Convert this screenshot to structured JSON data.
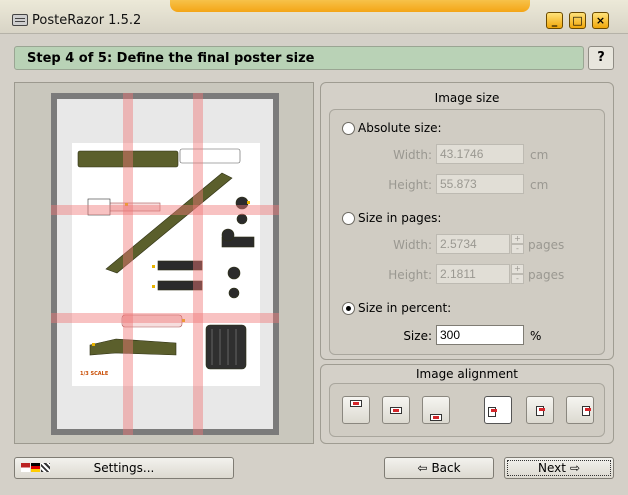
{
  "window": {
    "title": "PosteRazor 1.5.2",
    "minimize": "_",
    "maximize": "□",
    "close": "×"
  },
  "step": {
    "title": "Step 4 of 5: Define the final poster size",
    "help_label": "?"
  },
  "preview": {
    "scale_label": "1/3 SCALE"
  },
  "image_size": {
    "title": "Image size",
    "absolute": {
      "label": "Absolute size:",
      "width_label": "Width:",
      "width_value": "43.1746",
      "width_unit": "cm",
      "height_label": "Height:",
      "height_value": "55.873",
      "height_unit": "cm"
    },
    "pages": {
      "label": "Size in pages:",
      "width_label": "Width:",
      "width_value": "2.5734",
      "width_unit": "pages",
      "height_label": "Height:",
      "height_value": "2.1811",
      "height_unit": "pages"
    },
    "percent": {
      "label": "Size in percent:",
      "size_label": "Size:",
      "size_value": "300",
      "size_unit": "%"
    },
    "selected": "percent"
  },
  "image_alignment": {
    "title": "Image alignment",
    "selected_index": 3
  },
  "footer": {
    "settings_label": "Settings...",
    "back_label": "Back",
    "next_label": "Next",
    "back_arrow": "⇦",
    "next_arrow": "⇨"
  },
  "colors": {
    "step_bar": "#b9d2b6",
    "grid_overlay": "#f07878",
    "title_glow": "#f4a516",
    "olive_part": "#5b5f2c"
  }
}
